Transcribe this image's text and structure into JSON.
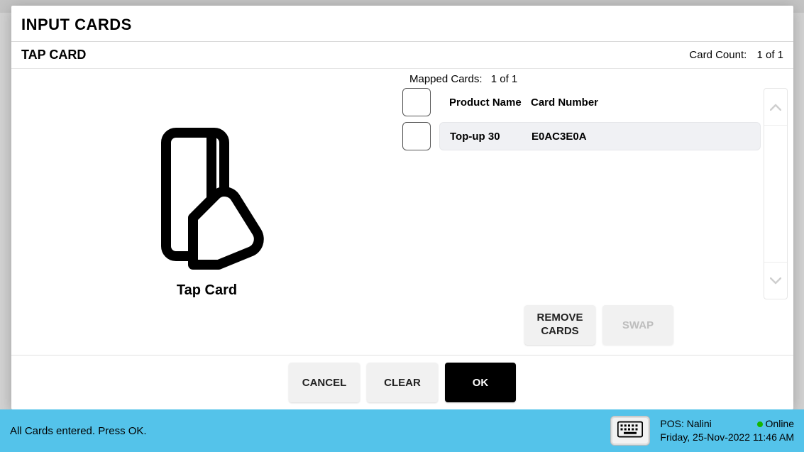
{
  "modal": {
    "title": "INPUT CARDS",
    "sub_title": "TAP CARD",
    "card_count_label": "Card Count:",
    "card_count_value": "1 of 1"
  },
  "left": {
    "caption": "Tap Card"
  },
  "mapped": {
    "label": "Mapped Cards:",
    "count": "1 of 1"
  },
  "columns": {
    "product": "Product Name",
    "number": "Card Number"
  },
  "rows": [
    {
      "product": "Top-up 30",
      "number": "E0AC3E0A"
    }
  ],
  "actions": {
    "remove": "REMOVE CARDS",
    "swap": "SWAP",
    "cancel": "CANCEL",
    "clear": "CLEAR",
    "ok": "OK"
  },
  "status": {
    "message": "All Cards entered. Press OK.",
    "pos_label": "POS:",
    "pos_value": "Nalini",
    "online": "Online",
    "datetime": "Friday, 25-Nov-2022 11:46 AM"
  }
}
